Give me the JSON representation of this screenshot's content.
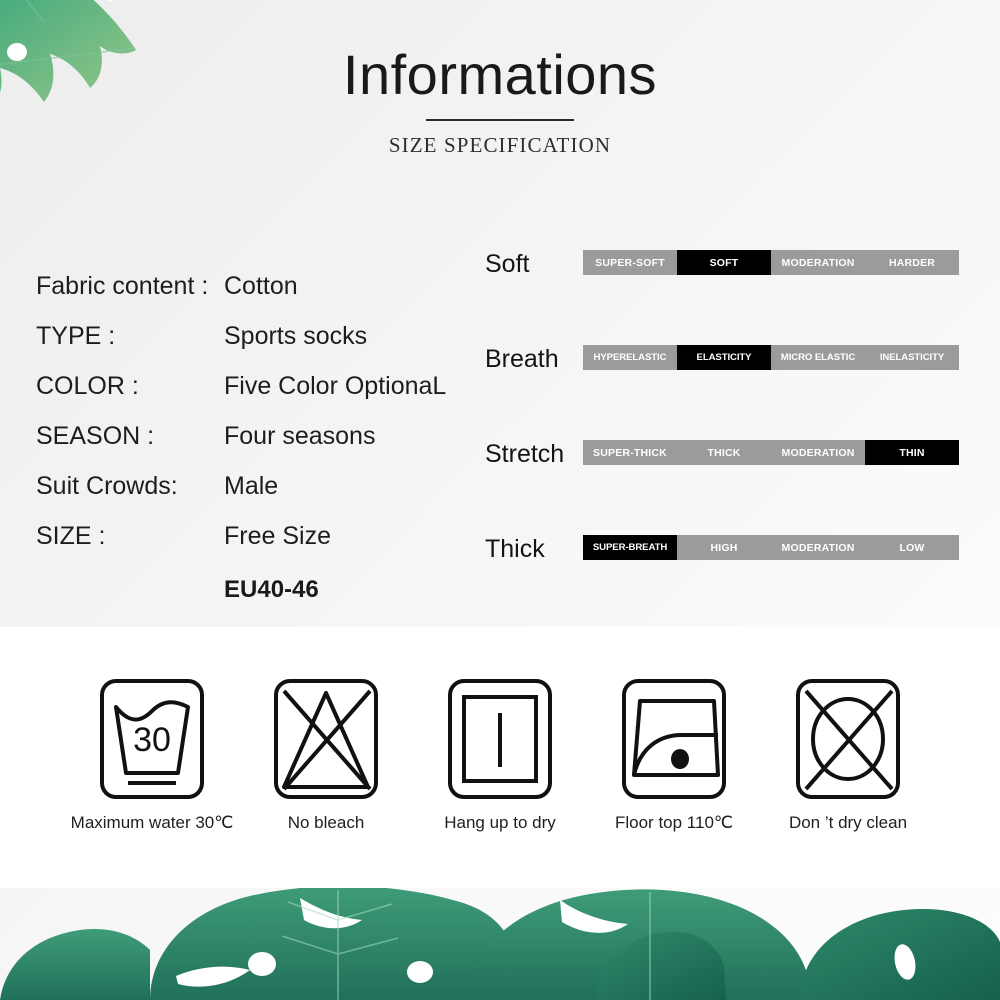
{
  "header": {
    "title": "Informations",
    "subtitle": "SIZE SPECIFICATION"
  },
  "specifications": [
    {
      "label": "Fabric content :",
      "value": "Cotton"
    },
    {
      "label": "TYPE :",
      "value": "Sports socks"
    },
    {
      "label": "COLOR :",
      "value": "Five Color OptionaL"
    },
    {
      "label": "SEASON :",
      "value": "Four seasons"
    },
    {
      "label": "Suit Crowds:",
      "value": "Male"
    },
    {
      "label": "SIZE :",
      "value": "Free Size",
      "extra": "EU40-46"
    }
  ],
  "ratings": [
    {
      "label": "Soft",
      "cells": [
        "SUPER-SOFT",
        "SOFT",
        "MODERATION",
        "HARDER"
      ],
      "active_index": 1
    },
    {
      "label": "Breath",
      "cells": [
        "HYPERELASTIC",
        "ELASTICITY",
        "MICRO ELASTIC",
        "INELASTICITY"
      ],
      "active_index": 1
    },
    {
      "label": "Stretch",
      "cells": [
        "SUPER-THICK",
        "THICK",
        "MODERATION",
        "THIN"
      ],
      "active_index": 3
    },
    {
      "label": "Thick",
      "cells": [
        "SUPER-BREATH",
        "HIGH",
        "MODERATION",
        "LOW"
      ],
      "active_index": 0
    }
  ],
  "care_instructions": [
    {
      "icon": "wash-tub-30-icon",
      "caption": "Maximum water 30℃",
      "temperature": "30"
    },
    {
      "icon": "no-bleach-icon",
      "caption": "No bleach"
    },
    {
      "icon": "hang-to-dry-icon",
      "caption": "Hang up to dry"
    },
    {
      "icon": "iron-one-dot-icon",
      "caption": "Floor top 110℃"
    },
    {
      "icon": "no-dry-clean-icon",
      "caption": "Don  ’t dry clean"
    }
  ],
  "colors": {
    "cell_inactive": "#9b9b9b",
    "cell_active": "#000000",
    "text_primary": "#1d1d1d",
    "leaf_green": "#3f9c78",
    "care_band": "#ffffff"
  }
}
